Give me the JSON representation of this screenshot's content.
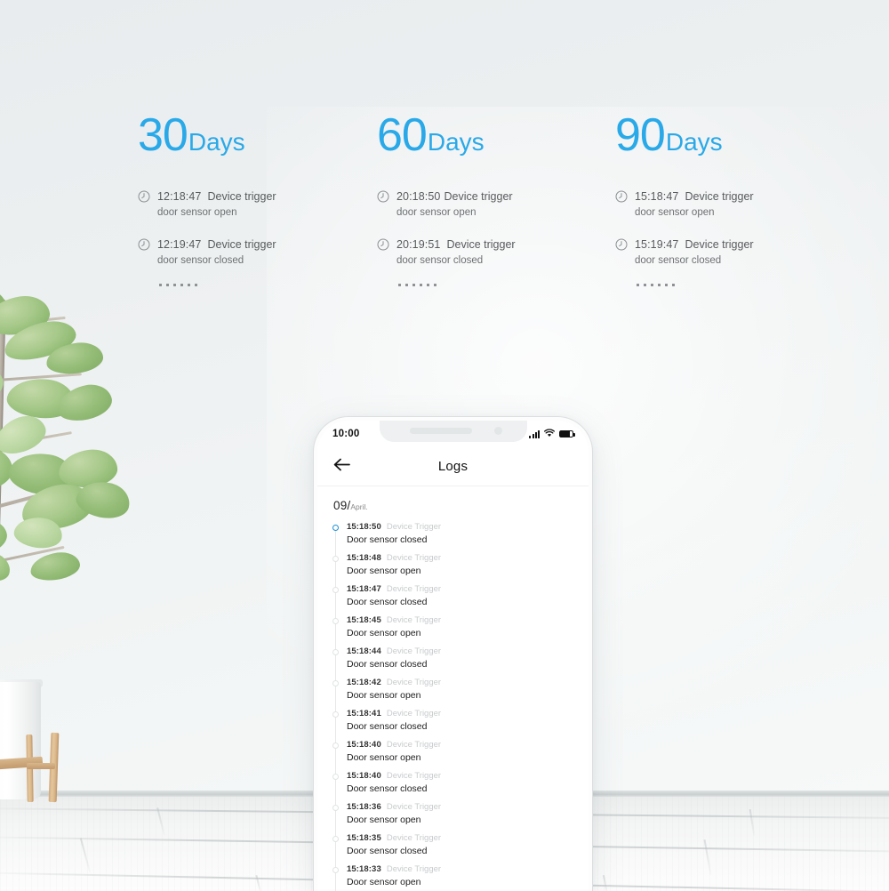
{
  "scene": {
    "background_top": "#e9edee",
    "background_bottom": "#fafbfb",
    "accent_blue": "#2aa9e8"
  },
  "retention_columns": [
    {
      "number": "30",
      "unit": "Days",
      "events": [
        {
          "icon": "clock-icon",
          "time": "12:18:47",
          "title": "Device trigger",
          "detail": "door sensor open"
        },
        {
          "icon": "clock-icon",
          "time": "12:19:47",
          "title": "Device trigger",
          "detail": "door sensor closed"
        }
      ],
      "ellipsis": "······"
    },
    {
      "number": "60",
      "unit": "Days",
      "events": [
        {
          "icon": "clock-icon",
          "time": "20:18:50",
          "title": "Device trigger",
          "detail": "door sensor open"
        },
        {
          "icon": "clock-icon",
          "time": "20:19:51",
          "title": "Device trigger",
          "detail": "door sensor closed"
        }
      ],
      "ellipsis": "······"
    },
    {
      "number": "90",
      "unit": "Days",
      "events": [
        {
          "icon": "clock-icon",
          "time": "15:18:47",
          "title": "Device trigger",
          "detail": "door sensor open"
        },
        {
          "icon": "clock-icon",
          "time": "15:19:47",
          "title": "Device trigger",
          "detail": "door sensor closed"
        }
      ],
      "ellipsis": "······"
    }
  ],
  "phone": {
    "statusbar": {
      "time": "10:00",
      "icons": [
        "signal-icon",
        "wifi-icon",
        "battery-icon"
      ]
    },
    "navbar": {
      "back_icon": "back-arrow-icon",
      "title": "Logs"
    },
    "log_screen": {
      "date_day": "09/",
      "date_month": "April.",
      "entries": [
        {
          "time": "15:18:50",
          "type": "Device Trigger",
          "message": "Door sensor closed",
          "active": true
        },
        {
          "time": "15:18:48",
          "type": "Device Trigger",
          "message": "Door sensor open",
          "active": false
        },
        {
          "time": "15:18:47",
          "type": "Device Trigger",
          "message": "Door sensor closed",
          "active": false
        },
        {
          "time": "15:18:45",
          "type": "Device Trigger",
          "message": "Door sensor open",
          "active": false
        },
        {
          "time": "15:18:44",
          "type": "Device Trigger",
          "message": "Door sensor closed",
          "active": false
        },
        {
          "time": "15:18:42",
          "type": "Device Trigger",
          "message": "Door sensor open",
          "active": false
        },
        {
          "time": "15:18:41",
          "type": "Device Trigger",
          "message": "Door sensor closed",
          "active": false
        },
        {
          "time": "15:18:40",
          "type": "Device Trigger",
          "message": "Door sensor open",
          "active": false
        },
        {
          "time": "15:18:40",
          "type": "Device Trigger",
          "message": "Door sensor closed",
          "active": false
        },
        {
          "time": "15:18:36",
          "type": "Device Trigger",
          "message": "Door sensor open",
          "active": false
        },
        {
          "time": "15:18:35",
          "type": "Device Trigger",
          "message": "Door sensor closed",
          "active": false
        },
        {
          "time": "15:18:33",
          "type": "Device Trigger",
          "message": "Door sensor open",
          "active": false
        }
      ]
    }
  }
}
